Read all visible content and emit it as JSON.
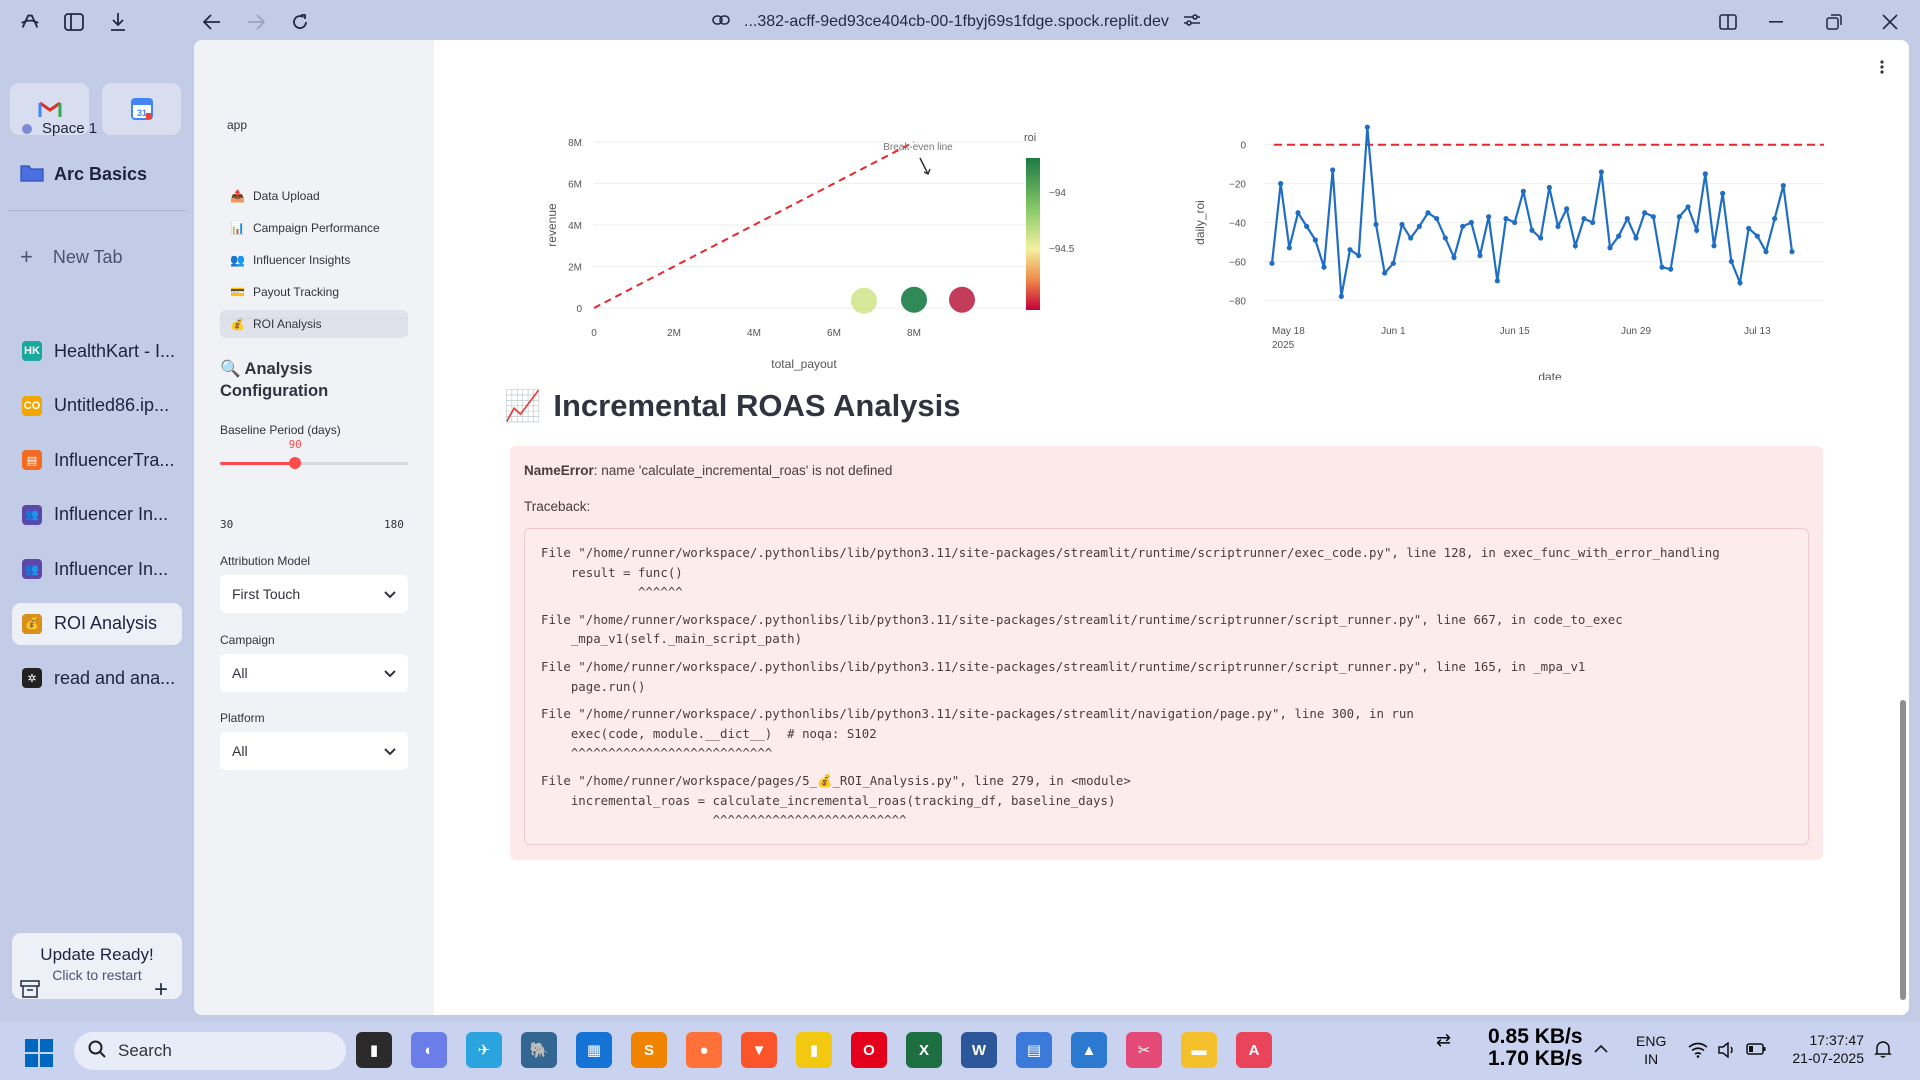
{
  "browser": {
    "url": "...382-acff-9ed93ce404cb-00-1fbyj69s1fdge.spock.replit.dev"
  },
  "arc": {
    "space": "Space 1",
    "folder": "Arc Basics",
    "new_tab": "New Tab",
    "tabs": [
      {
        "label": "HealthKart - I...",
        "icon": "HK",
        "color": "#1aa89c"
      },
      {
        "label": "Untitled86.ip...",
        "icon": "CO",
        "color": "#f2a600"
      },
      {
        "label": "InfluencerTra...",
        "icon": "▤",
        "color": "#f36b21"
      },
      {
        "label": "Influencer In...",
        "icon": "👥",
        "color": "#5b48a8"
      },
      {
        "label": "Influencer In...",
        "icon": "👥",
        "color": "#5b48a8"
      },
      {
        "label": "ROI Analysis",
        "icon": "💰",
        "color": "#d9901a"
      },
      {
        "label": "read and ana...",
        "icon": "✲",
        "color": "#222"
      }
    ],
    "update_title": "Update Ready!",
    "update_sub": "Click to restart"
  },
  "nav": {
    "app": "app",
    "items": [
      {
        "icon": "📤",
        "label": "Data Upload"
      },
      {
        "icon": "📊",
        "label": "Campaign Performance"
      },
      {
        "icon": "👥",
        "label": "Influencer Insights"
      },
      {
        "icon": "💳",
        "label": "Payout Tracking"
      },
      {
        "icon": "💰",
        "label": "ROI Analysis"
      }
    ]
  },
  "config": {
    "title_icon": "🔍",
    "title": "Analysis Configuration",
    "baseline_label": "Baseline Period (days)",
    "baseline_value": "90",
    "baseline_min": "30",
    "baseline_max": "180",
    "baseline_fraction": 0.4,
    "attribution_label": "Attribution Model",
    "attribution_value": "First Touch",
    "campaign_label": "Campaign",
    "campaign_value": "All",
    "platform_label": "Platform",
    "platform_value": "All"
  },
  "chart_data": [
    {
      "type": "scatter",
      "annotation": "Break-even line",
      "xlabel": "total_payout",
      "ylabel": "revenue",
      "xticks": [
        "0",
        "2M",
        "4M",
        "6M",
        "8M"
      ],
      "yticks": [
        "0",
        "2M",
        "4M",
        "6M",
        "8M"
      ],
      "xlim": [
        0,
        10000000
      ],
      "ylim": [
        0,
        8000000
      ],
      "colorbar_title": "roi",
      "colorbar_ticks": [
        "−94",
        "−94.5"
      ],
      "points": [
        {
          "x": 6750000,
          "y": 350000,
          "color": "#d6e89a"
        },
        {
          "x": 8000000,
          "y": 400000,
          "color": "#2f8a57"
        },
        {
          "x": 9200000,
          "y": 400000,
          "color": "#c33d5b"
        }
      ]
    },
    {
      "type": "line",
      "xlabel": "date",
      "ylabel": "daily_roi",
      "xticks": [
        "May 18\n2025",
        "Jun 1",
        "Jun 15",
        "Jun 29",
        "Jul 13"
      ],
      "yticks": [
        "0",
        "−20",
        "−40",
        "−60",
        "−80"
      ],
      "ylim": [
        -85,
        5
      ],
      "reference": 0,
      "values": [
        -61,
        -20,
        -53,
        -35,
        -42,
        -49,
        -63,
        -13,
        -78,
        -54,
        -57,
        9,
        -41,
        -66,
        -61,
        -41,
        -48,
        -42,
        -35,
        -38,
        -48,
        -58,
        -42,
        -40,
        -57,
        -37,
        -70,
        -38,
        -40,
        -24,
        -44,
        -48,
        -22,
        -42,
        -33,
        -52,
        -38,
        -40,
        -14,
        -53,
        -47,
        -38,
        -48,
        -35,
        -37,
        -63,
        -64,
        -37,
        -32,
        -44,
        -15,
        -52,
        -25,
        -60,
        -71,
        -43,
        -47,
        -55,
        -38,
        -21,
        -55
      ]
    }
  ],
  "section": {
    "icon": "📈",
    "title": "Incremental ROAS Analysis"
  },
  "error": {
    "type": "NameError",
    "message": ": name 'calculate_incremental_roas' is not defined",
    "traceback_label": "Traceback:",
    "lines": [
      "File \"/home/runner/workspace/.pythonlibs/lib/python3.11/site-packages/streamlit/runtime/scriptrunner/exec_code.py\", line 128, in exec_func_with_error_handling\n    result = func()\n             ^^^^^^",
      "File \"/home/runner/workspace/.pythonlibs/lib/python3.11/site-packages/streamlit/runtime/scriptrunner/script_runner.py\", line 667, in code_to_exec\n    _mpa_v1(self._main_script_path)",
      "File \"/home/runner/workspace/.pythonlibs/lib/python3.11/site-packages/streamlit/runtime/scriptrunner/script_runner.py\", line 165, in _mpa_v1\n    page.run()",
      "File \"/home/runner/workspace/.pythonlibs/lib/python3.11/site-packages/streamlit/navigation/page.py\", line 300, in run\n    exec(code, module.__dict__)  # noqa: S102\n    ^^^^^^^^^^^^^^^^^^^^^^^^^^^",
      "File \"/home/runner/workspace/pages/5_💰_ROI_Analysis.py\", line 279, in <module>\n    incremental_roas = calculate_incremental_roas(tracking_df, baseline_days)\n                       ^^^^^^^^^^^^^^^^^^^^^^^^^^"
    ]
  },
  "taskbar": {
    "search": "Search",
    "net_up": "0.85 KB/s",
    "net_down": "1.70 KB/s",
    "lang1": "ENG",
    "lang2": "IN",
    "time": "17:37:47",
    "date": "21-07-2025"
  }
}
